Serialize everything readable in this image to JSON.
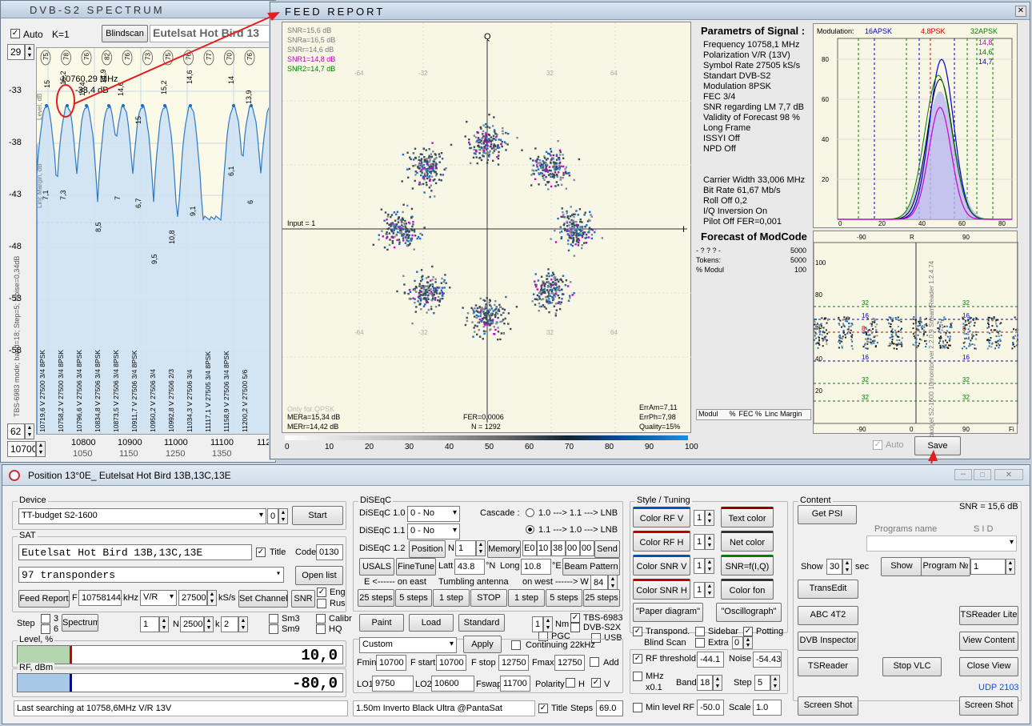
{
  "spectrum": {
    "title": "DVB-S2   SPECTRUM",
    "auto_label": "Auto",
    "k_label": "K=1",
    "blindscan_label": "Blindscan",
    "sat_title": "Eutelsat Hot Bird 13",
    "top_spin": "29",
    "bottom_spin": "62",
    "freq_start": "10700",
    "marker_freq": "10760,29 MHz",
    "marker_level": "-33,4 dB",
    "y_ticks": [
      "-33",
      "-38",
      "-43",
      "-48",
      "-53",
      "-58"
    ],
    "x_ticks": [
      "10800",
      "10900",
      "11000",
      "11100",
      "112"
    ],
    "x_sub": [
      "1050",
      "1150",
      "1250",
      "1350"
    ],
    "side_label": "TBS-6983 mode; band=18; Step=5; Noise=0,34dB",
    "linc_margin_label": "Linc Margin, dB",
    "level_label": "Level, dB",
    "circ_labels": [
      "75",
      "78",
      "76",
      "82",
      "76",
      "73",
      "75",
      "76",
      "77",
      "70",
      "76"
    ],
    "peak_labels": [
      "15",
      "15,2",
      "16,4",
      "14,9",
      "14,6",
      "15",
      "15,2",
      "14,6",
      "14",
      "13,9"
    ],
    "lower_labels": [
      "7,1",
      "7,3",
      "8,5",
      "7",
      "6,7",
      "9,1",
      "10,8",
      "9,5",
      "6,1",
      "6"
    ],
    "tp_labels": [
      "10719,6 V 27500 3/4 8PSK",
      "10758,2 V 27500 3/4 8PSK",
      "10796,6 V 27506 3/4 8PSK",
      "10834,8 V 27506 3/4 8PSK",
      "10873,5 V 27506 3/4 8PSK",
      "10911,7 V 27506 3/4 8PSK",
      "10950,2 V 27506 3/4",
      "10992,8 V 27506 2/3",
      "11034,3 V 27506 3/4",
      "11117,1 V 27505 3/4 8PSK",
      "11158,9 V 27506 3/4 8PSK",
      "11200,2 V 27500 5/6"
    ]
  },
  "feed": {
    "title": "FEED   REPORT",
    "const": {
      "snr_lines": [
        "SNR=15,6 dB",
        "SNRa=16,5 dB",
        "SNRr=14,6 dB",
        "SNR1=14,8 dB",
        "SNR2=14,7 dB"
      ],
      "snr_colors": [
        "#7a7a7a",
        "#7a7a7a",
        "#7a7a7a",
        "#c000c0",
        "#008000"
      ],
      "axis_q": "Q",
      "axis_i": "I",
      "input": "Input = 1",
      "only_qpsk": "Only for QPSK",
      "mera": "MERa=15,34 dB",
      "merr": "MERr=14,42 dB",
      "fer": "FER=0,0006",
      "n": "N = 1292",
      "erram": "ErrAm=7,11",
      "errph": "ErrPh=7,98",
      "quality": "Quality=15%",
      "grid_labels": [
        "-64",
        "-32",
        "32",
        "64"
      ]
    },
    "scale": [
      "0",
      "10",
      "20",
      "30",
      "40",
      "50",
      "60",
      "70",
      "80",
      "90",
      "100"
    ],
    "params_title": "Parametrs of Signal :",
    "params": [
      "Frequency  10758,1 MHz",
      "Polarization   V/R (13V)",
      "Symbol Rate  27505 kS/s",
      "Standart  DVB-S2",
      "Modulation   8PSK",
      "FEC  3/4",
      "SNR regarding LM  7,7 dB",
      "Validity of Forecast  98 %",
      "Long Frame",
      "ISSYI  Off",
      "NPD  Off"
    ],
    "params2": [
      "Carrier Width   33,006 MHz",
      "Bit Rate  61,67 Mb/s",
      "Roll Off   0,2",
      "I/Q Inversion    On",
      "Pilot   Off        FER=0,001"
    ],
    "forecast_title": "Forecast of ModCode",
    "forecast_rows": [
      [
        "- ? ? ? -",
        "5000"
      ],
      [
        "Tokens:",
        "5000"
      ],
      [
        "% Modul",
        "100"
      ]
    ],
    "modul_headers": [
      "Modul",
      "%",
      "FEC %",
      "Linc Margin"
    ],
    "hist": {
      "modulation_label": "Modulation:",
      "m1": "16APSK",
      "m2": "4,8PSK",
      "m3": "32APSK",
      "v1": "14,8",
      "v2": "14,6",
      "v3": "14,7",
      "y_ticks": [
        "80",
        "60",
        "40",
        "20"
      ],
      "x_ticks": [
        "0",
        "20",
        "40",
        "60",
        "80"
      ]
    },
    "eye": {
      "top_ticks": [
        "-90",
        "R",
        "90"
      ],
      "bottom_ticks": [
        "-90",
        "0",
        "90"
      ],
      "y_ticks": [
        "100",
        "80",
        "60",
        "40",
        "20"
      ],
      "l32": "32",
      "l16": "16",
      "l8": "8",
      "corner": "Fi"
    },
    "side_text": "TT-budget S2-1600   10monitor ver 2.2.0.9   StreamReader 1.2.4.74",
    "auto_label": "Auto",
    "save_label": "Save"
  },
  "main": {
    "title": "Position 13°0E_  Eutelsat Hot Bird 13B,13C,13E",
    "device_group": "Device",
    "device_value": "TT-budget S2-1600",
    "device_num": "0",
    "start_label": "Start",
    "sat_group": "SAT",
    "sat_value": "Eutelsat Hot Bird 13B,13C,13E",
    "title_chk": "Title",
    "code_label": "Code",
    "code_value": "0130",
    "transponders": "97  transponders",
    "open_list": "Open list",
    "feed_report": "Feed Report",
    "f_label": "F",
    "freq_value": "10758144",
    "khz": "kHz",
    "pol_value": "V/R",
    "sr_value": "27500",
    "ksps": "kS/s",
    "set_channel": "Set Channel",
    "snr_btn": "SNR",
    "eng": "Eng",
    "rus": "Rus",
    "step_label": "Step",
    "step3": "3",
    "step6": "6",
    "spectrum_btn": "Spectrum",
    "n1": "1",
    "n_label": "N",
    "n2": "2500",
    "k_label": "k",
    "k_val": "2",
    "sm3": "Sm3",
    "sm9": "Sm9",
    "calibr": "Calibr",
    "hq": "HQ",
    "level_group": "Level, %",
    "level_value": "10,0",
    "rf_group": "RF, dBm",
    "rf_value": "-80,0",
    "status": "Last searching at 10758,6MHz  V/R  13V",
    "diseqc_group": "DiSEqC",
    "d10": "DiSEqC 1.0",
    "d11": "DiSEqC 1.1",
    "d12": "DiSEqC 1.2",
    "d10_val": "0 - No",
    "d11_val": "0 - No",
    "cascade": "Cascade :",
    "cas1": "1.0 ---> 1.1 ---> LNB",
    "cas2": "1.1 ---> 1.0 ---> LNB",
    "position_btn": "Position",
    "pos_n": "N",
    "pos_val": "1",
    "memory_btn": "Memory",
    "bytes": [
      "E0",
      "10",
      "38",
      "00",
      "00"
    ],
    "send_btn": "Send",
    "usals": "USALS",
    "finetune": "FineTune",
    "latt": "Latt",
    "latt_val": "43.8",
    "n_deg": "°N",
    "long": "Long",
    "long_val": "10.8",
    "e_deg": "°E",
    "beam": "Beam Pattern",
    "east": "E <------ on east",
    "tumbling": "Tumbling antenna",
    "west": "on west ------> W",
    "w_val": "84",
    "steps": [
      "25 steps",
      "5 steps",
      "1 step",
      "STOP",
      "1 step",
      "5 steps",
      "25 steps"
    ],
    "paint": "Paint",
    "load": "Load",
    "standard": "Standard",
    "nm_val": "1",
    "nm": "Nm",
    "tbs": "TBS-6983",
    "dvbs2x": "DVB-S2X",
    "pgc": "PGC",
    "usb": "USB",
    "custom": "Custom",
    "apply": "Apply",
    "continuing": "Continuing 22kHz",
    "fmin": "Fmin",
    "fmin_val": "10700",
    "fstart": "F start",
    "fstart_val": "10700",
    "fstop": "F stop",
    "fstop_val": "12750",
    "fmax": "Fmax",
    "fmax_val": "12750",
    "add": "Add",
    "lo1": "LO1",
    "lo1_val": "9750",
    "lo2": "LO2",
    "lo2_val": "10600",
    "fswap": "Fswap",
    "fswap_val": "11700",
    "polarity": "Polarity",
    "h": "H",
    "v": "V",
    "lnb_text": "1.50m  Inverto Black Ultra @PantaSat",
    "title2": "Title",
    "steps_label": "Steps",
    "steps_val": "69.0",
    "style_group": "Style / Tuning",
    "color_rf_v": "Color  RF V",
    "color_rf_h": "Color  RF H",
    "color_snr_v": "Color  SNR V",
    "color_snr_h": "Color  SNR H",
    "spin1": "1",
    "text_color": "Text color",
    "net_color": "Net color",
    "snr_fiq": "SNR=f(I,Q)",
    "color_fon": "Color fon",
    "paper": "\"Paper diagram\"",
    "oscillograph": "\"Oscillograph\"",
    "transpond": "Transpond.",
    "sidebar": "Sidebar",
    "potting": "Potting",
    "blind": "Blind  Scan",
    "extra": "Extra",
    "extra_val": "0",
    "rf_threshold": "RF threshold",
    "rf_thr_val": "-44.1",
    "noise": "Noise",
    "noise_val": "-54.43",
    "mhz": "MHz",
    "x01": "x0.1",
    "band": "Band",
    "band_val": "18",
    "step2": "Step",
    "step2_val": "5",
    "min_level": "Min level RF",
    "min_val": "-50.0",
    "scale": "Scale",
    "scale_val": "1.0",
    "content_group": "Content",
    "snr_text": "SNR = 15,6 dB",
    "get_psi": "Get  PSI",
    "prog_name": "Programs  name",
    "sid": "S I D",
    "show": "Show",
    "show_val": "30",
    "sec": "sec",
    "show_btn": "Show",
    "program": "Program  №",
    "prog_val": "1",
    "transedit": "TransEdit",
    "abc": "ABC 4T2",
    "tsreader_lite": "TSReader Lite",
    "dvb_inspector": "DVB Inspector",
    "view_content": "View Content",
    "tsreader": "TSReader",
    "stop_vlc": "Stop  VLC",
    "close_view": "Close View",
    "udp": "UDP 2103",
    "screenshot": "Screen Shot"
  },
  "colors": {
    "accent": "#1a6cc4",
    "magenta": "#d000d0",
    "red": "#e02020",
    "green": "#008000",
    "blue": "#0000e0"
  }
}
